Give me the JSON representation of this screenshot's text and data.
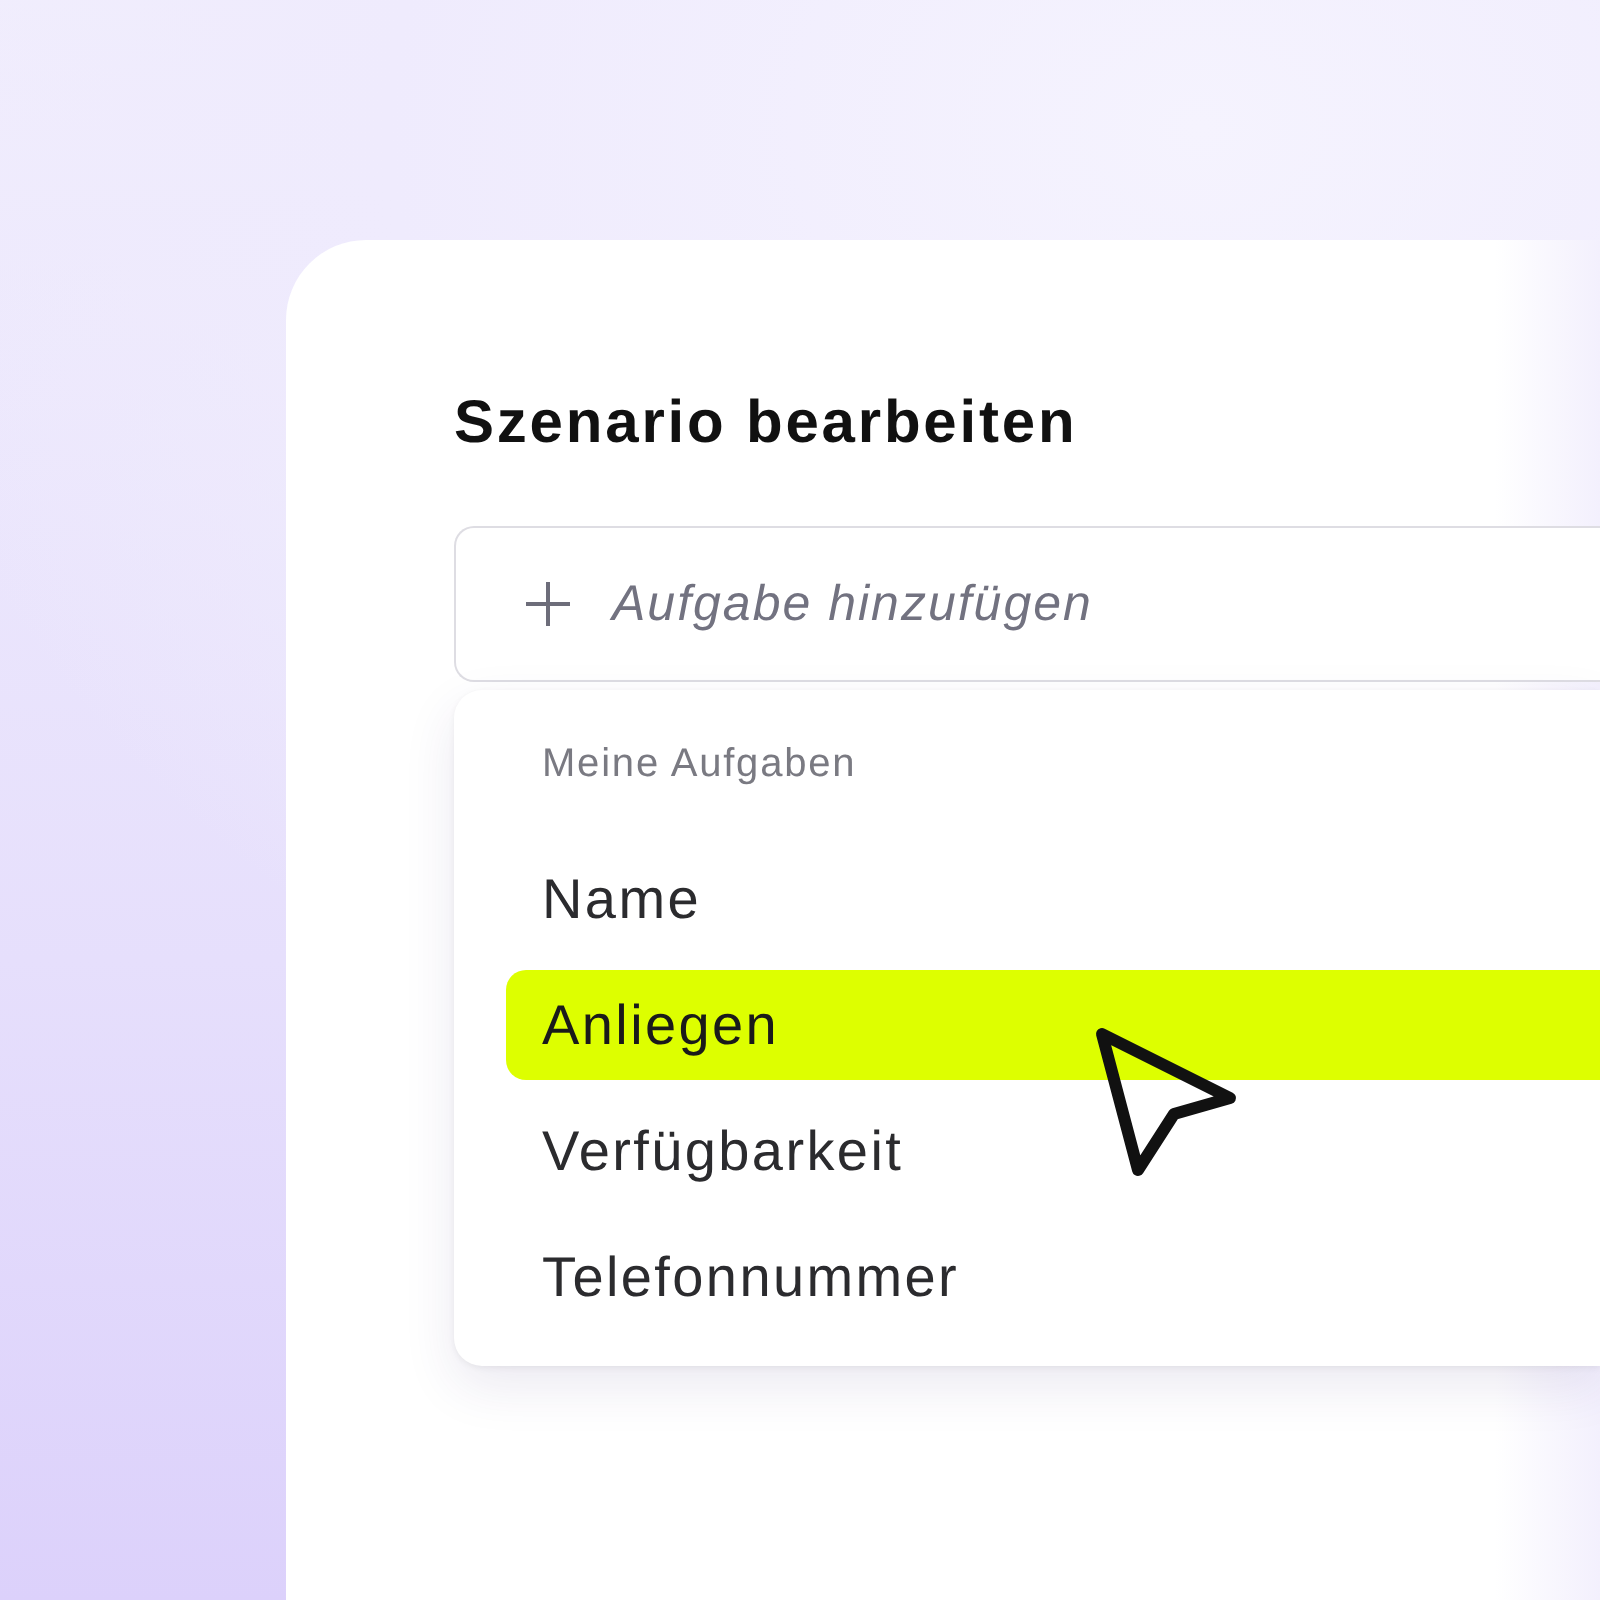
{
  "editor": {
    "title": "Szenario bearbeiten",
    "add_field": {
      "placeholder": "Aufgabe hinzufügen"
    },
    "dropdown": {
      "heading": "Meine Aufgaben",
      "items": [
        {
          "label": "Name",
          "selected": false
        },
        {
          "label": "Anliegen",
          "selected": true
        },
        {
          "label": "Verfügbarkeit",
          "selected": false
        },
        {
          "label": "Telefonnummer",
          "selected": false
        }
      ]
    }
  }
}
